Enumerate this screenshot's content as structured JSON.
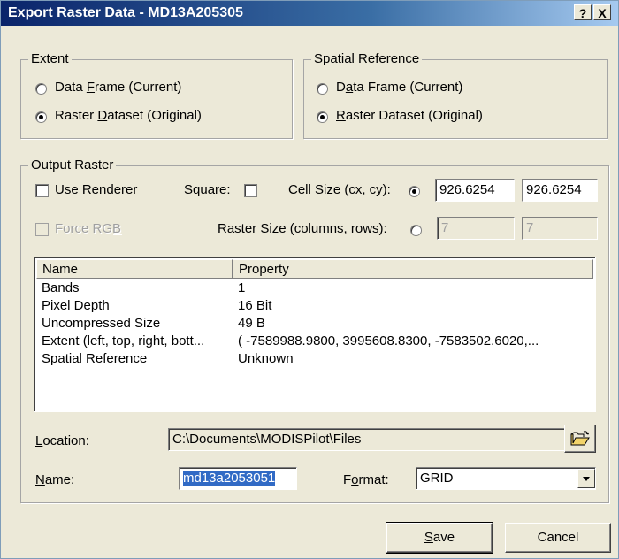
{
  "window": {
    "title": "Export Raster Data - MD13A205305",
    "help_label": "?",
    "close_label": "X"
  },
  "extent": {
    "legend": "Extent",
    "options": [
      {
        "pre": "Data ",
        "key": "F",
        "post": "rame (Current)",
        "checked": false
      },
      {
        "pre": "Raster ",
        "key": "D",
        "post": "ataset (Original)",
        "checked": true
      }
    ]
  },
  "spatial_reference": {
    "legend": "Spatial Reference",
    "options": [
      {
        "pre": "D",
        "key": "a",
        "post": "ta Frame (Current)",
        "checked": false
      },
      {
        "pre": "",
        "key": "R",
        "post": "aster Dataset (Original)",
        "checked": true
      }
    ]
  },
  "output": {
    "legend": "Output Raster",
    "use_renderer": {
      "pre": "",
      "key": "U",
      "post": "se Renderer",
      "checked": false
    },
    "square": {
      "pre": "S",
      "key": "q",
      "post": "uare:",
      "checked": false
    },
    "cell_size": {
      "label": "Cell Size (cx, cy):",
      "checked": true,
      "cx": "926.6254",
      "cy": "926.6254"
    },
    "force_rgb": {
      "pre": "Force RG",
      "key": "B",
      "post": "",
      "disabled": true
    },
    "raster_size": {
      "pre": "Raster Si",
      "key": "z",
      "post": "e (columns, rows):",
      "checked": false,
      "columns": "7",
      "rows": "7"
    }
  },
  "properties": {
    "headers": [
      "Name",
      "Property"
    ],
    "rows": [
      {
        "name": "Bands",
        "value": "1"
      },
      {
        "name": "Pixel Depth",
        "value": "16 Bit"
      },
      {
        "name": "Uncompressed Size",
        "value": "49 B"
      },
      {
        "name": "Extent (left, top, right, bott...",
        "value": "( -7589988.9800, 3995608.8300, -7583502.6020,..."
      },
      {
        "name": "Spatial Reference",
        "value": "Unknown"
      }
    ]
  },
  "location": {
    "pre": "",
    "key": "L",
    "post": "ocation:",
    "value": "C:\\Documents\\MODISPilot\\Files",
    "browse_icon": "open-folder-icon"
  },
  "name": {
    "pre": "",
    "key": "N",
    "post": "ame:",
    "value": "md13a2053051"
  },
  "format": {
    "pre": "F",
    "key": "o",
    "post": "rmat:",
    "value": "GRID"
  },
  "buttons": {
    "save": {
      "pre": "",
      "key": "S",
      "post": "ave"
    },
    "cancel": "Cancel"
  }
}
